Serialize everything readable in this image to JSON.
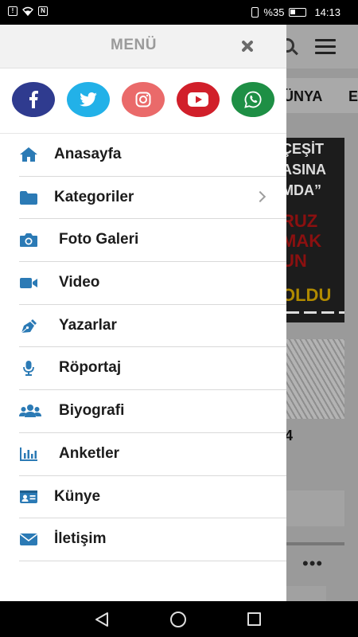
{
  "status_bar": {
    "battery_percent": "%35",
    "time": "14:13",
    "left_icons": [
      "sim-alert-icon",
      "wifi-icon",
      "nfc-icon"
    ],
    "right_icons": [
      "vibrate-icon",
      "battery-icon"
    ]
  },
  "drawer": {
    "title": "MENÜ",
    "social": [
      {
        "name": "facebook",
        "glyph": "f",
        "color": "#2f3b8f"
      },
      {
        "name": "twitter",
        "glyph": "twitter",
        "color": "#22b1e8"
      },
      {
        "name": "instagram",
        "glyph": "instagram",
        "color": "#ea6a6a"
      },
      {
        "name": "youtube",
        "glyph": "youtube",
        "color": "#d11f2a"
      },
      {
        "name": "whatsapp",
        "glyph": "whatsapp",
        "color": "#1e8f45"
      }
    ],
    "menu_items": [
      {
        "label": "Anasayfa",
        "icon": "home-icon"
      },
      {
        "label": "Kategoriler",
        "icon": "folder-icon",
        "has_arrow": true
      },
      {
        "label": "Foto Galeri",
        "icon": "camera-icon"
      },
      {
        "label": "Video",
        "icon": "video-camera-icon"
      },
      {
        "label": "Yazarlar",
        "icon": "pen-nib-icon"
      },
      {
        "label": "Röportaj",
        "icon": "microphone-icon"
      },
      {
        "label": "Biyografi",
        "icon": "users-icon"
      },
      {
        "label": "Anketler",
        "icon": "bar-chart-icon"
      },
      {
        "label": "Künye",
        "icon": "id-card-icon"
      },
      {
        "label": "İletişim",
        "icon": "envelope-icon"
      }
    ],
    "accent_color": "#2b7ab5"
  },
  "background_app": {
    "categories": [
      "ÜNYA",
      "E"
    ],
    "banner_lines": [
      "ÇEŞİT",
      "ASINA",
      "MDA”",
      "RUZ",
      "MAK",
      "UN",
      "OLDU"
    ],
    "partial_number": "4"
  }
}
